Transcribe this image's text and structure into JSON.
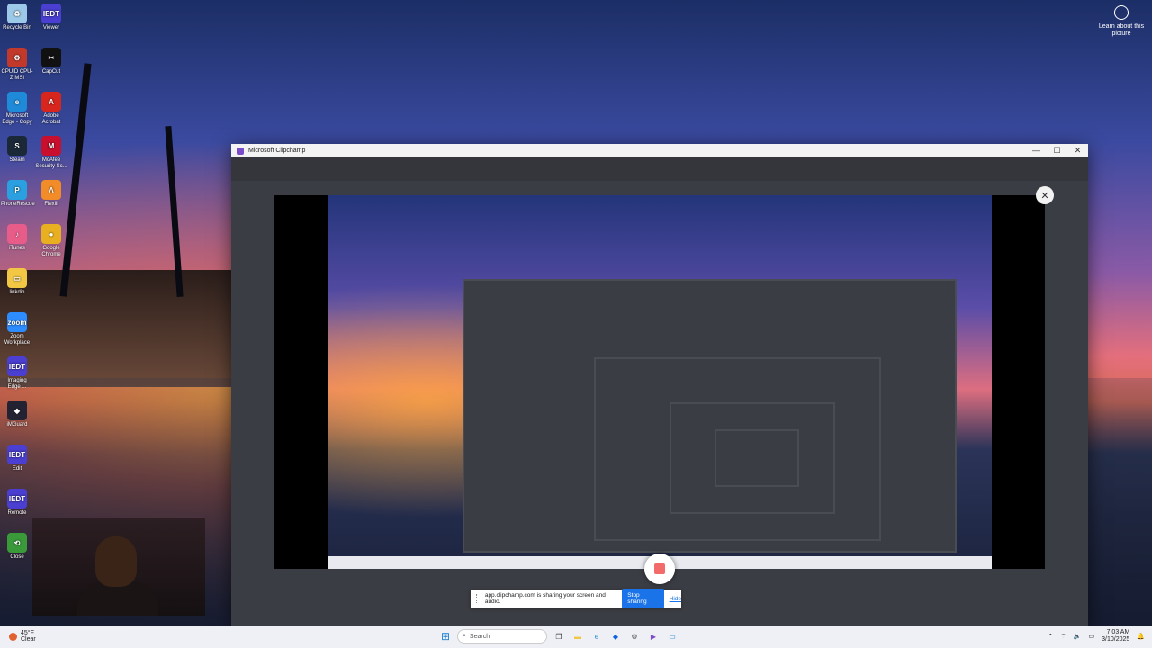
{
  "desktop": {
    "learn_about": "Learn about this picture",
    "icons": [
      {
        "label": "Recycle Bin",
        "glyph": "♻",
        "color": "#9cc9e8"
      },
      {
        "label": "Viewer",
        "glyph": "IEDT",
        "color": "#4a3fd0"
      },
      {
        "label": "CPUID CPU-Z MSI",
        "glyph": "⚙",
        "color": "#c0392b"
      },
      {
        "label": "CapCut",
        "glyph": "✂",
        "color": "#111111"
      },
      {
        "label": "Microsoft Edge - Copy",
        "glyph": "e",
        "color": "#1f8ad8"
      },
      {
        "label": "Adobe Acrobat",
        "glyph": "A",
        "color": "#d7261e"
      },
      {
        "label": "Steam",
        "glyph": "S",
        "color": "#1b2838"
      },
      {
        "label": "McAfee Security Sc...",
        "glyph": "M",
        "color": "#c8102e"
      },
      {
        "label": "PhoneRescue",
        "glyph": "P",
        "color": "#2aa0e0"
      },
      {
        "label": "Flexiil",
        "glyph": "Λ",
        "color": "#f28c28"
      },
      {
        "label": "iTunes",
        "glyph": "♪",
        "color": "#e85c8a"
      },
      {
        "label": "Google Chrome",
        "glyph": "●",
        "color": "#e8b020"
      },
      {
        "label": "linkdin",
        "glyph": "▭",
        "color": "#f2c744"
      },
      {
        "label": "Zoom Workplace",
        "glyph": "zoom",
        "color": "#2d8cff"
      },
      {
        "label": "Imaging Edge ...",
        "glyph": "IEDT",
        "color": "#4a3fd0"
      },
      {
        "label": "iMGuard",
        "glyph": "◆",
        "color": "#222233"
      },
      {
        "label": "Edit",
        "glyph": "IEDT",
        "color": "#4a3fd0"
      },
      {
        "label": "Remote",
        "glyph": "IEDT",
        "color": "#4a3fd0"
      },
      {
        "label": "Close",
        "glyph": "⟲",
        "color": "#3a9a3a"
      }
    ]
  },
  "window": {
    "title": "Microsoft Clipchamp",
    "minimize": "—",
    "maximize": "☐",
    "close": "✕",
    "preview_close": "✕"
  },
  "share_bar": {
    "message": "app.clipchamp.com is sharing your screen and audio.",
    "stop_label": "Stop sharing",
    "hide_label": "Hide"
  },
  "taskbar": {
    "weather_temp": "45°F",
    "weather_desc": "Clear",
    "search_placeholder": "Search",
    "time": "7:03 AM",
    "date": "3/10/2025",
    "apps": [
      {
        "name": "file-explorer",
        "glyph": "▬",
        "color": "#f2c744"
      },
      {
        "name": "edge",
        "glyph": "e",
        "color": "#1f8ad8"
      },
      {
        "name": "dropbox",
        "glyph": "◆",
        "color": "#1060e0"
      },
      {
        "name": "settings",
        "glyph": "⚙",
        "color": "#555555"
      },
      {
        "name": "clipchamp",
        "glyph": "▶",
        "color": "#7a4cc9"
      },
      {
        "name": "screen-app",
        "glyph": "▭",
        "color": "#1a7fd0"
      }
    ]
  }
}
